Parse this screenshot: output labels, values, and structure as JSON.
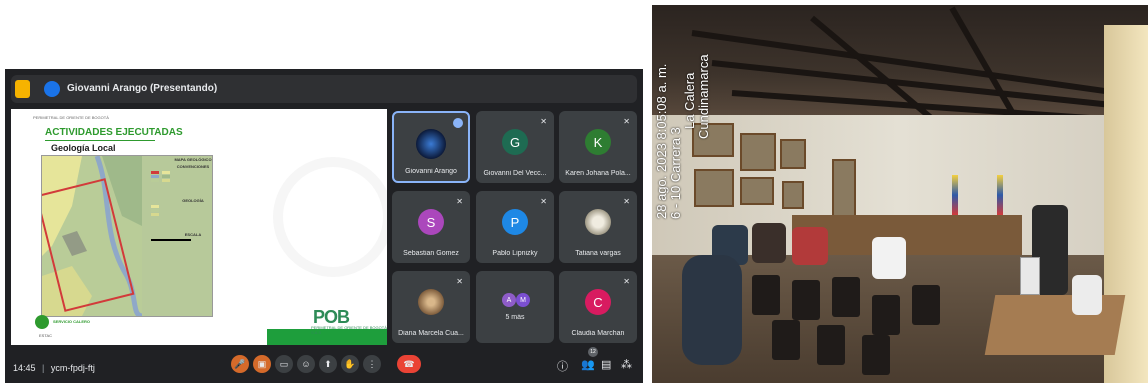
{
  "meeting": {
    "presenter_bar": "Giovanni Arango (Presentando)",
    "slide": {
      "header_small": "PERIMETRAL DE ORIENTE DE BOGOTÁ",
      "title": "ACTIVIDADES EJECUTADAS",
      "subtitle": "Geología Local",
      "legend_title": "MAPA GEOLÓGICO",
      "legend_sections": [
        "CONVENCIONES",
        "GEOLOGÍA",
        "ESCALA"
      ],
      "logo_left": "SERVICIO CALERO",
      "logo_left_sub": "ESTAC",
      "pob_logo": "POB",
      "pob_sub": "PERIMETRAL DE ORIENTE DE BOGOTÁ S.A.S"
    },
    "participants": [
      {
        "name": "Giovanni Arango",
        "initial": "",
        "color": "#1f3a6b",
        "active": true
      },
      {
        "name": "Giovanni Del Vecc...",
        "initial": "G",
        "color": "#1e6b52"
      },
      {
        "name": "Karen Johana Pola...",
        "initial": "K",
        "color": "#2e7d32"
      },
      {
        "name": "Sebastian Gomez",
        "initial": "S",
        "color": "#ab47bc"
      },
      {
        "name": "Pablo Lipnizky",
        "initial": "P",
        "color": "#1e88e5"
      },
      {
        "name": "Tatiana vargas",
        "initial": "",
        "color": "#cfc9b8"
      },
      {
        "name": "Diana Marcela Cua...",
        "initial": "",
        "color": "#b08a60"
      },
      {
        "name": "5 más",
        "initial": "",
        "color": "#3c4043"
      },
      {
        "name": "Claudia Marchan",
        "initial": "C",
        "color": "#d81b60"
      }
    ],
    "more_initials": [
      "A",
      "M"
    ],
    "time": "14:45",
    "separator": "|",
    "meeting_code": "ycm-fpdj-ftj",
    "participant_count": "12"
  },
  "photo": {
    "stamp_lines": [
      "28 ago. 2023 8:05:08 a. m.",
      "6 - 10 Carrera 3",
      "La Calera",
      "Cundinamarca"
    ]
  }
}
